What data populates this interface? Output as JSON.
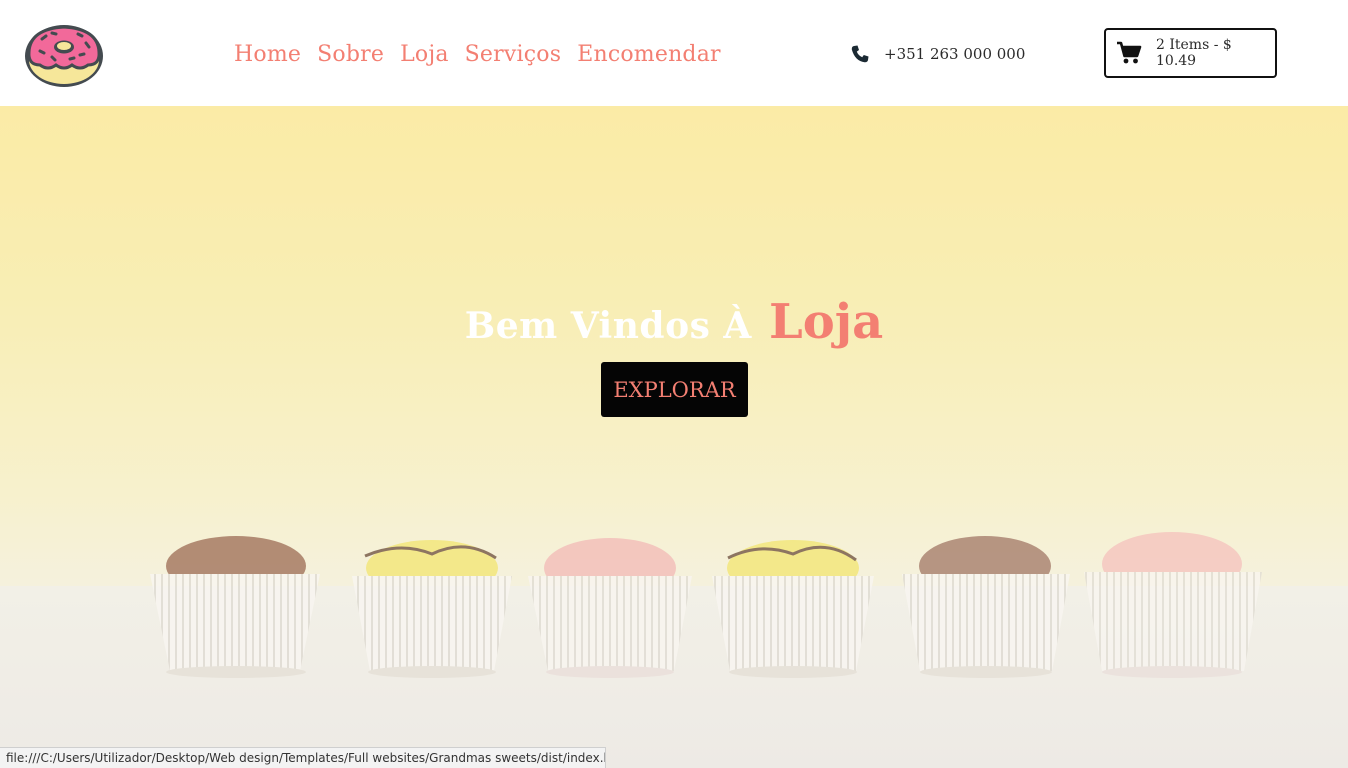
{
  "header": {
    "logo_icon": "donut-icon",
    "nav": [
      {
        "label": "Home"
      },
      {
        "label": "Sobre"
      },
      {
        "label": "Loja"
      },
      {
        "label": "Serviços"
      },
      {
        "label": "Encomendar"
      }
    ],
    "phone": {
      "icon": "phone-icon",
      "number": "+351 263 000 000"
    },
    "cart": {
      "icon": "cart-icon",
      "summary": "2 Items - $ 10.49"
    }
  },
  "hero": {
    "welcome_text": "Bem Vindos À",
    "brand_text": "Loja",
    "explore_label": "EXPLORAR",
    "background_image": "cupcakes-photo"
  },
  "statusbar": {
    "url": "file:///C:/Users/Utilizador/Desktop/Web design/Templates/Full websites/Grandmas sweets/dist/index.html#store"
  },
  "colors": {
    "accent": "#f37f72",
    "button_bg": "#050505",
    "hero_top": "#fbe99a",
    "hero_bottom": "#eeebe6"
  }
}
